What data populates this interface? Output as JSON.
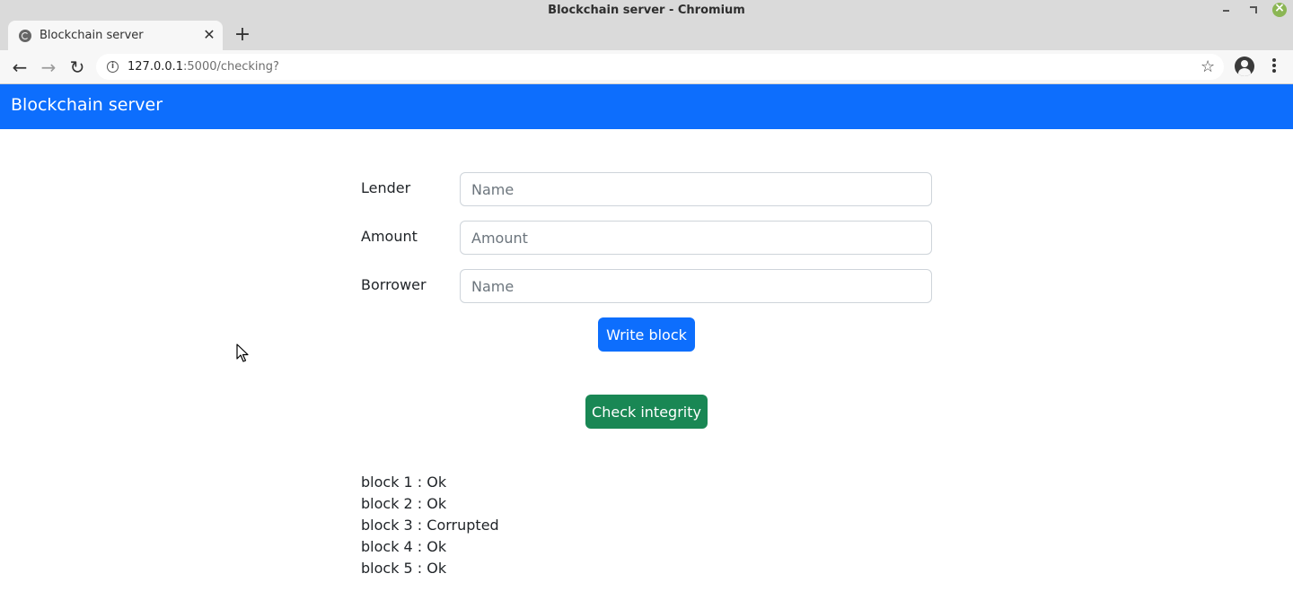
{
  "window": {
    "title": "Blockchain server - Chromium"
  },
  "tab": {
    "title": "Blockchain server",
    "close_glyph": "✕",
    "new_tab_glyph": "+"
  },
  "toolbar": {
    "back_glyph": "←",
    "forward_glyph": "→",
    "reload_glyph": "↻",
    "url_host": "127.0.0.1",
    "url_rest": ":5000/checking?",
    "info_glyph": "i",
    "star_glyph": "☆"
  },
  "navbar": {
    "brand": "Blockchain server",
    "color": "#0d6efd"
  },
  "form": {
    "fields": [
      {
        "label": "Lender",
        "placeholder": "Name",
        "value": ""
      },
      {
        "label": "Amount",
        "placeholder": "Amount",
        "value": ""
      },
      {
        "label": "Borrower",
        "placeholder": "Name",
        "value": ""
      }
    ],
    "write_button": "Write block",
    "write_button_color": "#0d6efd"
  },
  "check": {
    "button": "Check integrity",
    "button_color": "#198754"
  },
  "results": [
    "block 1 : Ok",
    "block 2 : Ok",
    "block 3 : Corrupted",
    "block 4 : Ok",
    "block 5 : Ok"
  ]
}
